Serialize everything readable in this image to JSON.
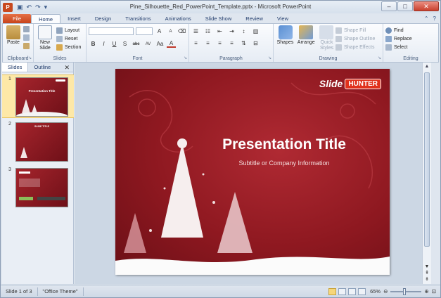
{
  "window": {
    "title": "Pine_Silhouette_Red_PowerPoint_Template.pptx - Microsoft PowerPoint",
    "app_icon": "P"
  },
  "tabs": [
    "File",
    "Home",
    "Insert",
    "Design",
    "Transitions",
    "Animations",
    "Slide Show",
    "Review",
    "View"
  ],
  "ribbon": {
    "clipboard": {
      "paste": "Paste",
      "label": "Clipboard"
    },
    "slides": {
      "new_slide": "New Slide",
      "layout": "Layout",
      "reset": "Reset",
      "section": "Section",
      "label": "Slides"
    },
    "font": {
      "label": "Font",
      "buttons": [
        "B",
        "I",
        "U",
        "S",
        "abc",
        "AV",
        "Aa",
        "A"
      ]
    },
    "paragraph": {
      "label": "Paragraph"
    },
    "drawing": {
      "shapes": "Shapes",
      "arrange": "Arrange",
      "quick_styles": "Quick Styles",
      "shape_fill": "Shape Fill",
      "shape_outline": "Shape Outline",
      "shape_effects": "Shape Effects",
      "label": "Drawing"
    },
    "editing": {
      "find": "Find",
      "replace": "Replace",
      "select": "Select",
      "label": "Editing"
    }
  },
  "pane": {
    "tabs": [
      "Slides",
      "Outline"
    ],
    "thumbnails": [
      {
        "number": "1",
        "title": "Presentation Title"
      },
      {
        "number": "2",
        "title": "SLIDE TITLE"
      },
      {
        "number": "3",
        "title": ""
      }
    ]
  },
  "slide": {
    "title": "Presentation Title",
    "subtitle": "Subtitle or Company Information",
    "logo_part1": "Slide",
    "logo_part2": "HUNTER"
  },
  "status": {
    "slide_info": "Slide 1 of 3",
    "theme": "\"Office Theme\"",
    "zoom": "65%"
  },
  "colors": {
    "slide_red": "#8e1820",
    "file_tab": "#c7431b",
    "logo_badge": "#e0311c"
  }
}
